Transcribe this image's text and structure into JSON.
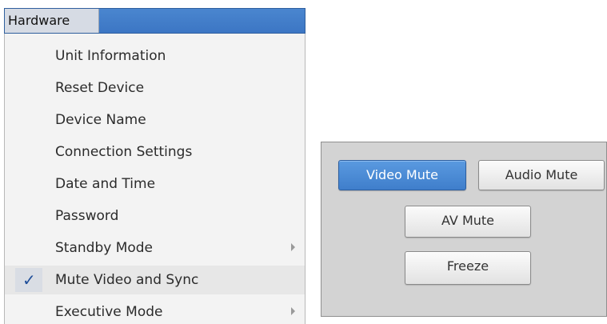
{
  "menu": {
    "title": "Hardware",
    "items": [
      {
        "label": "Unit Information"
      },
      {
        "label": "Reset Device"
      },
      {
        "label": "Device Name"
      },
      {
        "label": "Connection Settings"
      },
      {
        "label": "Date and Time"
      },
      {
        "label": "Password"
      },
      {
        "label": "Standby Mode",
        "has_submenu": true
      },
      {
        "label": "Mute Video and Sync",
        "checked": true,
        "check_symbol": "✓"
      },
      {
        "label": "Executive Mode",
        "has_submenu": true
      }
    ]
  },
  "mute_panel": {
    "video_mute_label": "Video Mute",
    "video_mute_active": true,
    "audio_mute_label": "Audio Mute",
    "av_mute_label": "AV Mute",
    "freeze_label": "Freeze"
  },
  "colors": {
    "accent": "#3f7ecb",
    "menu_bar": "#4a86cf",
    "check": "#1f4f9a"
  }
}
